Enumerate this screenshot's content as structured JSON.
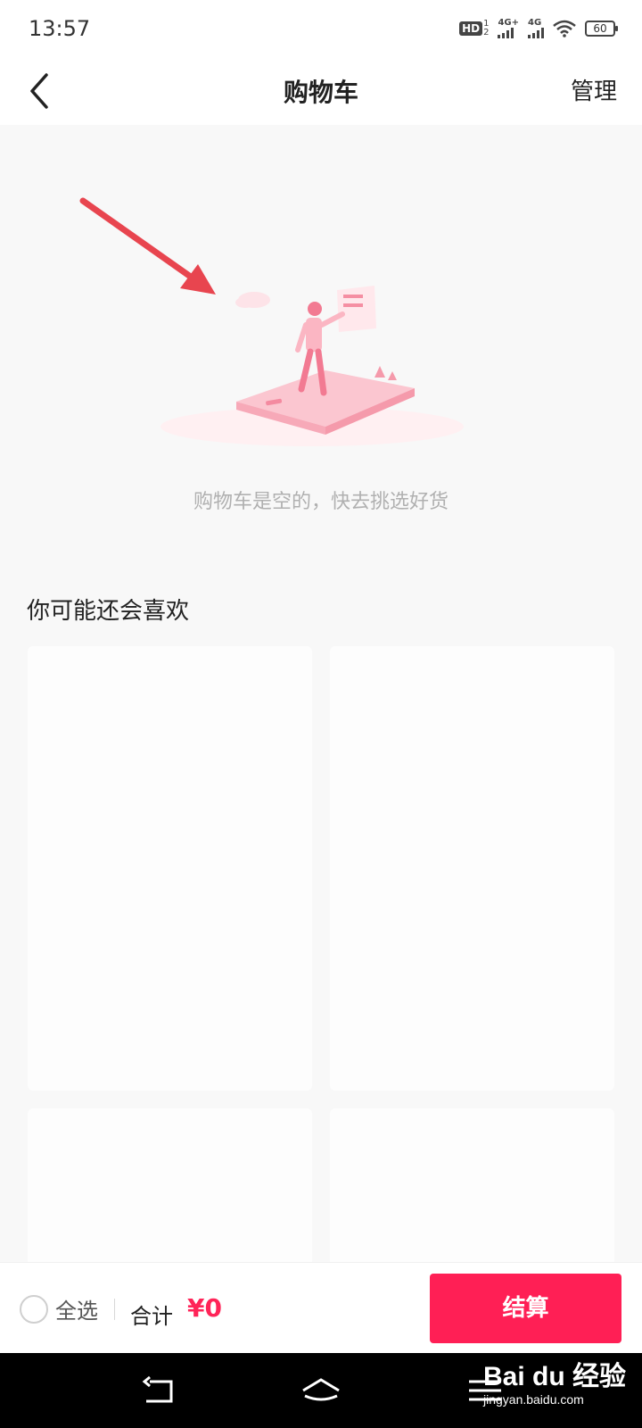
{
  "status_bar": {
    "time": "13:57",
    "hd_label": "HD",
    "hd_sub_top": "1",
    "hd_sub_bottom": "2",
    "net1_label": "4G+",
    "net2_label": "4G",
    "battery_level": "60"
  },
  "header": {
    "back_icon": "chevron-left-icon",
    "title": "购物车",
    "manage_label": "管理"
  },
  "empty_state": {
    "message": "购物车是空的，快去挑选好货"
  },
  "recommendations": {
    "title": "你可能还会喜欢"
  },
  "checkout_bar": {
    "select_all_label": "全选",
    "total_label": "合计",
    "total_value": "¥0",
    "checkout_label": "结算"
  },
  "colors": {
    "accent": "#ff1f55",
    "price": "#ff2458",
    "annotation_arrow": "#e8454f"
  },
  "watermark": {
    "logo_text": "Bai du 经验",
    "url": "jingyan.baidu.com"
  }
}
